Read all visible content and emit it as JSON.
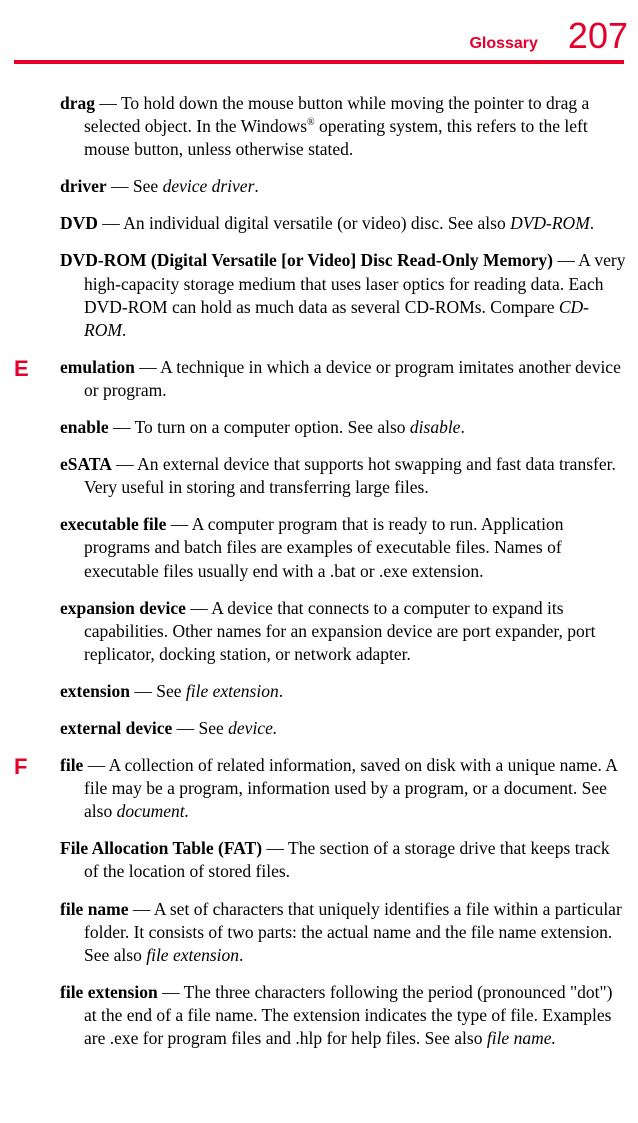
{
  "header": {
    "title": "Glossary",
    "page_number": "207"
  },
  "entries": [
    {
      "letter": "",
      "term": "drag",
      "dash": " — ",
      "def_before": "To hold down the mouse button while moving the pointer to drag a selected object. In the Windows",
      "reg": "®",
      "def_after": " operating system, this refers to the left mouse button, unless otherwise stated.",
      "italic_ref": ""
    },
    {
      "letter": "",
      "term": "driver",
      "dash": " — ",
      "def_before": "See ",
      "reg": "",
      "def_after": ".",
      "italic_ref": "device driver"
    },
    {
      "letter": "",
      "term": "DVD",
      "dash": " — ",
      "def_before": "An individual digital versatile (or video) disc. See also ",
      "reg": "",
      "def_after": ".",
      "italic_ref": "DVD-ROM"
    },
    {
      "letter": "",
      "term": "DVD-ROM (Digital Versatile [or Video] Disc Read-Only Memory)",
      "dash": " — ",
      "def_before": "A very high-capacity storage medium that uses laser optics for reading data. Each DVD-ROM can hold as much data as several CD-ROMs. Compare ",
      "reg": "",
      "def_after": ".",
      "italic_ref": "CD-ROM"
    },
    {
      "letter": "E",
      "term": "emulation",
      "dash": " — ",
      "def_before": "A technique in which a device or program imitates another device or program.",
      "reg": "",
      "def_after": "",
      "italic_ref": ""
    },
    {
      "letter": "",
      "term": "enable",
      "dash": " — ",
      "def_before": "To turn on a computer option. See also ",
      "reg": "",
      "def_after": ".",
      "italic_ref": "disable"
    },
    {
      "letter": "",
      "term": "eSATA",
      "dash": " — ",
      "def_before": "An external device that supports hot swapping and fast data transfer. Very useful in storing and transferring large files.",
      "reg": "",
      "def_after": "",
      "italic_ref": ""
    },
    {
      "letter": "",
      "term": "executable file",
      "dash": " — ",
      "def_before": "A computer program that is ready to run. Application programs and batch files are examples of executable files. Names of executable files usually end with a .bat or .exe extension.",
      "reg": "",
      "def_after": "",
      "italic_ref": ""
    },
    {
      "letter": "",
      "term": "expansion device",
      "dash": " — ",
      "def_before": "A device that connects to a computer to expand its capabilities. Other names for an expansion device are port expander, port replicator, docking station, or network adapter.",
      "reg": "",
      "def_after": "",
      "italic_ref": ""
    },
    {
      "letter": "",
      "term": "extension",
      "dash": " — ",
      "def_before": "See ",
      "reg": "",
      "def_after": ".",
      "italic_ref": "file extension"
    },
    {
      "letter": "",
      "term": "external device",
      "dash": " — ",
      "def_before": "See ",
      "reg": "",
      "def_after": "",
      "italic_ref": "device."
    },
    {
      "letter": "F",
      "term": "file",
      "dash": " — ",
      "def_before": "A collection of related information, saved on disk with a unique name. A file may be a program, information used by a program, or a document. See also ",
      "reg": "",
      "def_after": "",
      "italic_ref": "document."
    },
    {
      "letter": "",
      "term": "File Allocation Table (FAT)",
      "dash": " — ",
      "def_before": "The section of a storage drive that keeps track of the location of stored files.",
      "reg": "",
      "def_after": "",
      "italic_ref": ""
    },
    {
      "letter": "",
      "term": "file name",
      "dash": " — ",
      "def_before": "A set of characters that uniquely identifies a file within a particular folder. It consists of two parts: the actual name and the file name extension. See also ",
      "reg": "",
      "def_after": ".",
      "italic_ref": "file extension"
    },
    {
      "letter": "",
      "term": "file extension",
      "dash": " — ",
      "def_before": "The three characters following the period (pronounced \"dot\") at the end of a file name. The extension indicates the type of file. Examples are .exe for program files and .hlp for help files. See also ",
      "reg": "",
      "def_after": "",
      "italic_ref": "file name."
    }
  ]
}
